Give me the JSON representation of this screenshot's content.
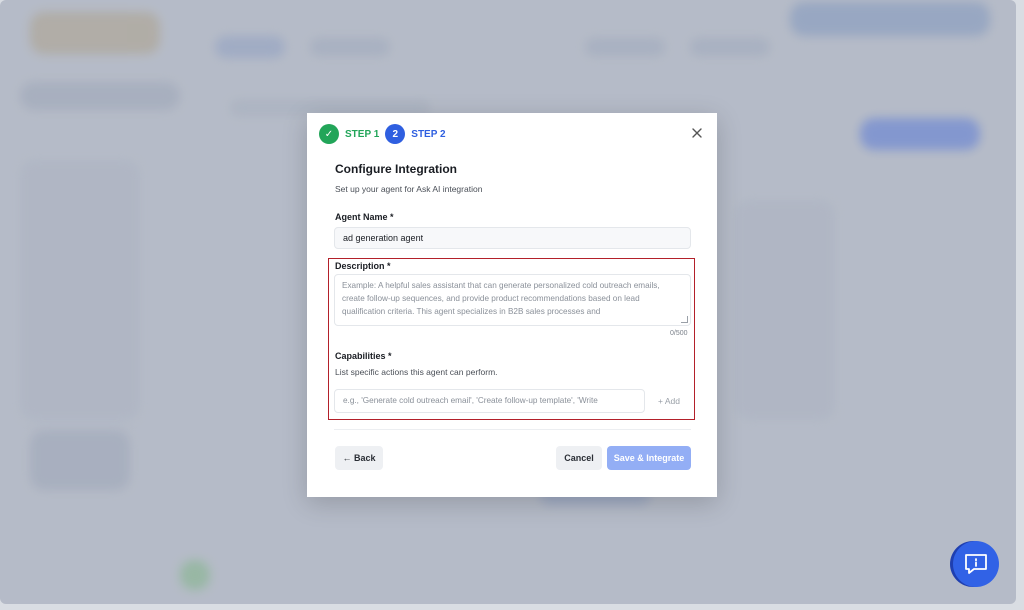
{
  "steps": [
    {
      "number": "✓",
      "label": "STEP 1",
      "state": "done"
    },
    {
      "number": "2",
      "label": "STEP 2",
      "state": "active"
    }
  ],
  "modal": {
    "title": "Configure Integration",
    "subtitle": "Set up your agent for Ask AI integration",
    "close_icon": "close-icon"
  },
  "agent_name": {
    "label": "Agent Name",
    "required_mark": "*",
    "value": "ad generation agent"
  },
  "description": {
    "label": "Description",
    "required_mark": "*",
    "placeholder": "Example: A helpful sales assistant that can generate personalized cold outreach emails, create follow-up sequences, and provide product recommendations based on lead qualification criteria. This agent specializes in B2B sales processes and",
    "char_count": "0/500"
  },
  "capabilities": {
    "label": "Capabilities",
    "required_mark": "*",
    "hint": "List specific actions this agent can perform.",
    "placeholder": "e.g., 'Generate cold outreach email', 'Create follow-up template', 'Write",
    "add_label": "+ Add"
  },
  "footer": {
    "back_label": "← Back",
    "cancel_label": "Cancel",
    "save_label": "Save & Integrate"
  },
  "colors": {
    "step_done": "#22a559",
    "step_active": "#2f5fe0",
    "highlight_border": "#b3202a",
    "save_button": "#93aef5",
    "help_fab": "#3162e6"
  },
  "help_fab": {
    "icon": "chat-help-icon"
  }
}
